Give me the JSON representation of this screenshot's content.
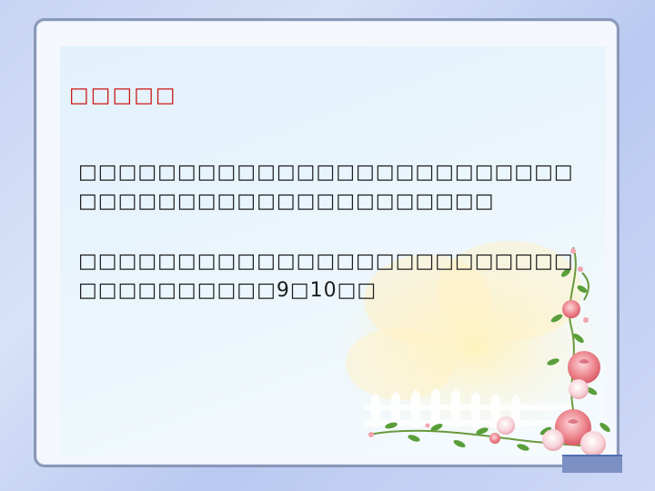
{
  "slide": {
    "title": "□□□□□",
    "paragraphs": [
      "□□□□□□□□□□□□□□□□□□□□□□□□□□□□□□□□□□□□□□□□□□□□□□",
      "□□□□□□□□□□□□□□□□□□□□□□□□□□□□□□□□□□□9□10□□"
    ]
  },
  "colors": {
    "title": "#cc1616",
    "text": "#1d1d1d",
    "frame_border": "#8a98b8",
    "background": "#c7d4f3",
    "panel": "#e6f3fb",
    "rose": "#e8757e",
    "leaf": "#5a9e3a"
  },
  "decorations": [
    "rose-corner-icon",
    "picket-fence-icon"
  ]
}
